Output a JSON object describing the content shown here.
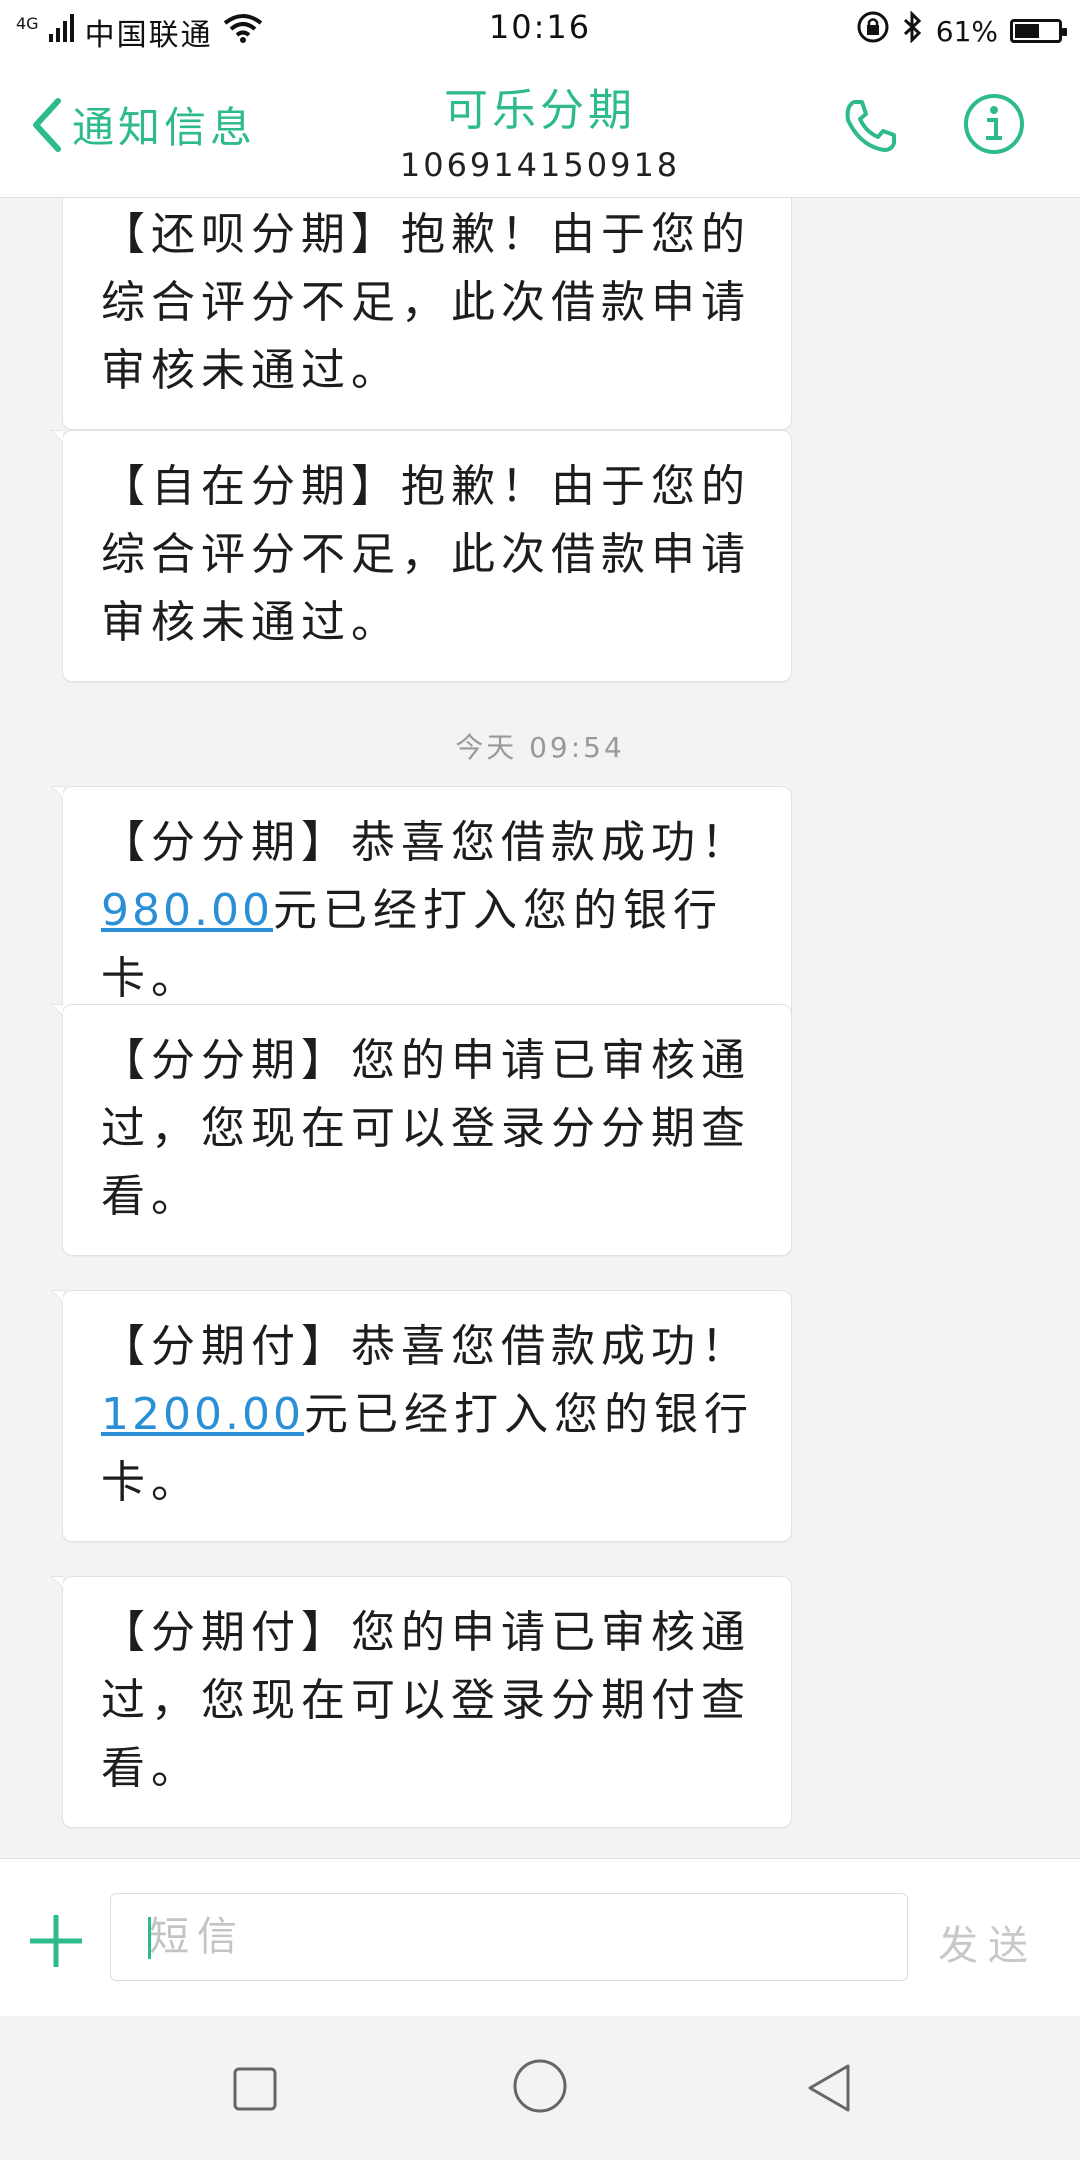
{
  "status_bar": {
    "network_type": "4G",
    "carrier": "中国联通",
    "time": "10:16",
    "battery_percent": "61%",
    "battery_level": 0.61
  },
  "header": {
    "back_label": "通知信息",
    "contact_name": "可乐分期",
    "contact_number": "106914150918"
  },
  "messages": [
    {
      "text": "【还呗分期】抱歉！由于您的综合评分不足，此次借款申请审核未通过。"
    },
    {
      "text": "【自在分期】抱歉！由于您的综合评分不足，此次借款申请审核未通过。"
    },
    {
      "timestamp": "今天 09:54"
    },
    {
      "prefix": "【分分期】恭喜您借款成功！",
      "amount": "980.00",
      "suffix": "元已经打入您的银行卡。"
    },
    {
      "text": "【分分期】您的申请已审核通过，您现在可以登录分分期查看。"
    },
    {
      "prefix": "【分期付】恭喜您借款成功！",
      "amount": "1200.00",
      "suffix": "元已经打入您的银行卡。"
    },
    {
      "text": "【分期付】您的申请已审核通过，您现在可以登录分期付查看。"
    }
  ],
  "composer": {
    "placeholder": "短信",
    "send_label": "发送"
  },
  "colors": {
    "accent": "#2dbb8a",
    "link": "#2b8fd6"
  },
  "icons": [
    "signal-icon",
    "wifi-icon",
    "rotation-lock-icon",
    "bluetooth-icon",
    "battery-icon",
    "back-chevron-icon",
    "phone-icon",
    "info-icon",
    "plus-icon",
    "recents-icon",
    "home-icon",
    "back-triangle-icon"
  ]
}
